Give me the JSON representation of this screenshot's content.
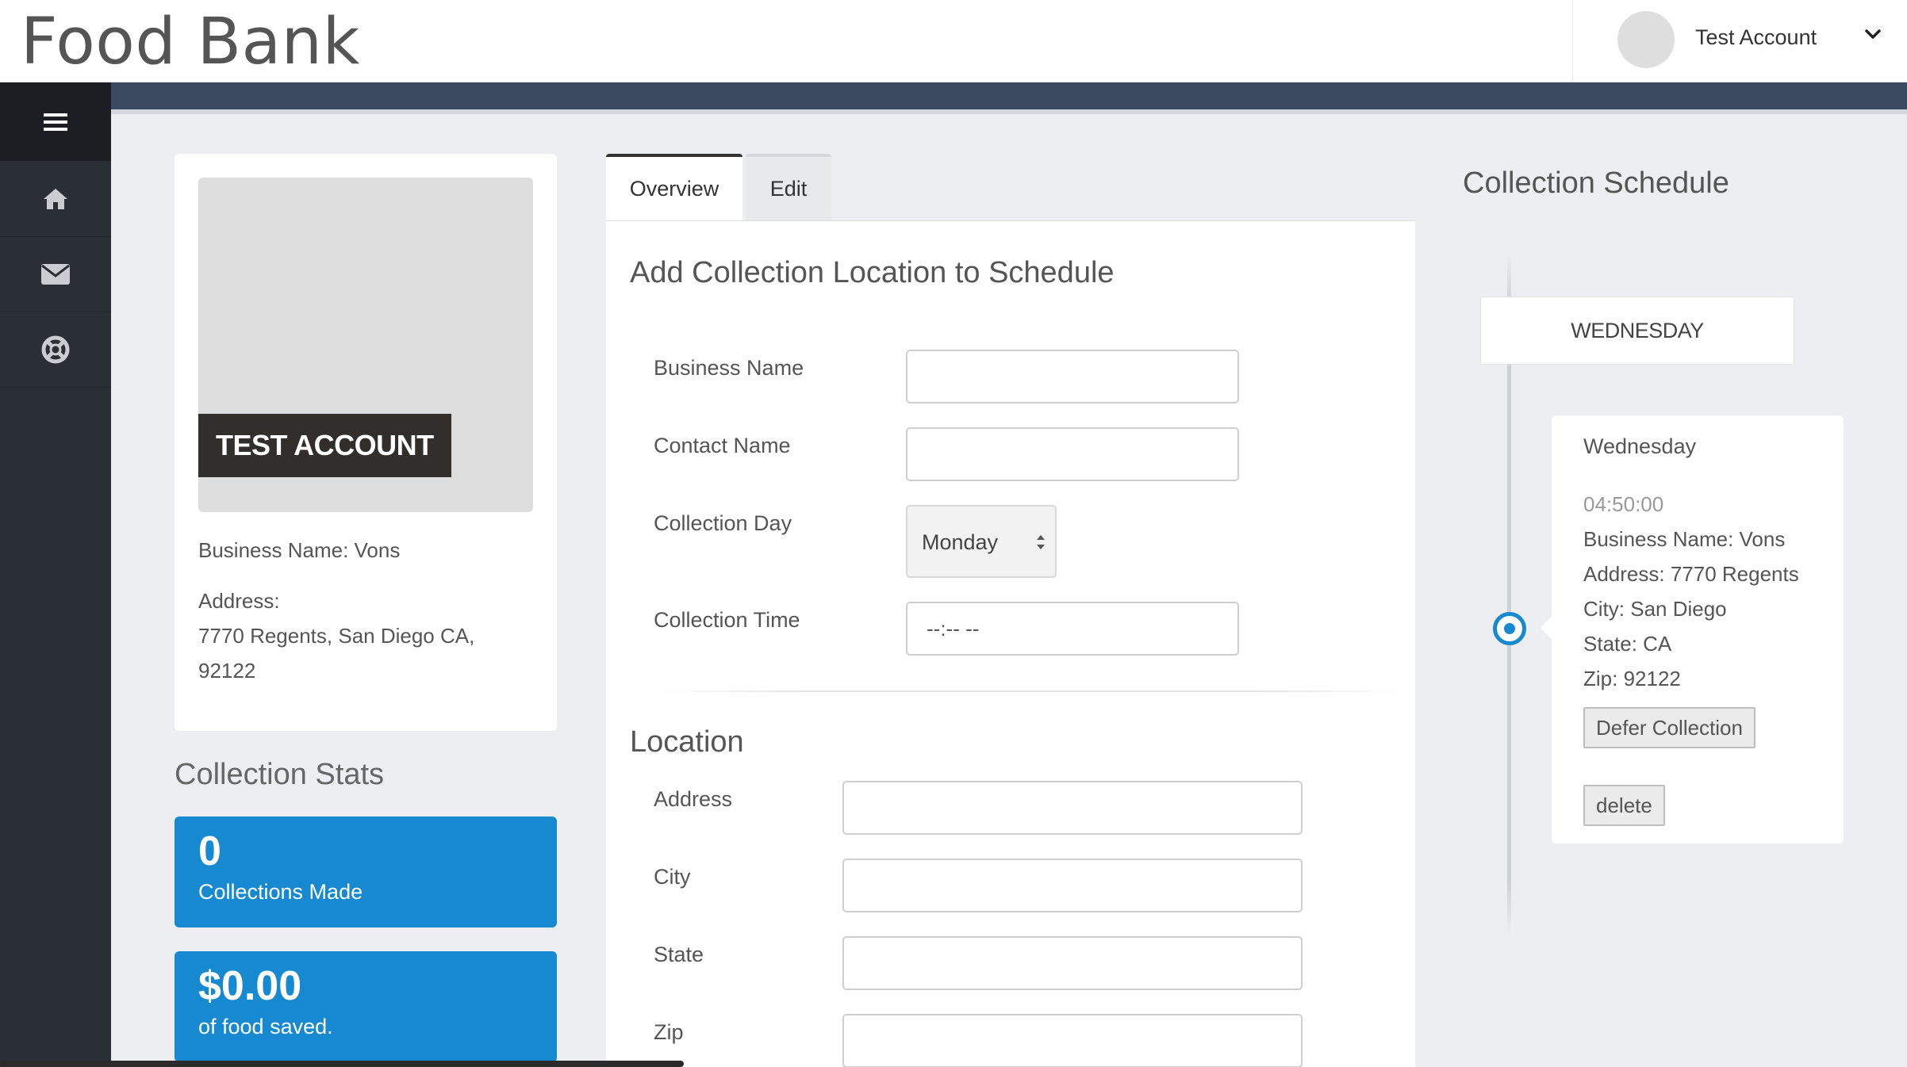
{
  "header": {
    "brand": "Food Bank",
    "account_name": "Test Account",
    "account_menu_icon": "chevron-down-icon"
  },
  "sidebar": {
    "items": [
      {
        "icon": "menu-icon"
      },
      {
        "icon": "home-icon"
      },
      {
        "icon": "mail-icon"
      },
      {
        "icon": "lifebuoy-icon"
      }
    ]
  },
  "profile": {
    "tag": "TEST ACCOUNT",
    "business_line": "Business Name: Vons",
    "address_label": "Address:",
    "address_line1": "7770 Regents, San Diego CA,",
    "address_line2": "92122"
  },
  "stats": {
    "title": "Collection Stats",
    "collections_value": "0",
    "collections_label": "Collections Made",
    "saved_value": "$0.00",
    "saved_label": "of food saved.",
    "accent": "#1789d1"
  },
  "tabs": [
    {
      "label": "Overview",
      "active": true
    },
    {
      "label": "Edit",
      "active": false
    }
  ],
  "form": {
    "title": "Add Collection Location to Schedule",
    "business_name_label": "Business Name",
    "business_name_value": "",
    "contact_name_label": "Contact Name",
    "contact_name_value": "",
    "collection_day_label": "Collection Day",
    "collection_day_value": "Monday",
    "collection_time_label": "Collection Time",
    "collection_time_value": "--:-- --",
    "location_title": "Location",
    "address_label": "Address",
    "address_value": "",
    "city_label": "City",
    "city_value": "",
    "state_label": "State",
    "state_value": "",
    "zip_label": "Zip",
    "zip_value": ""
  },
  "schedule": {
    "title": "Collection Schedule",
    "day_header": "WEDNESDAY",
    "event": {
      "day": "Wednesday",
      "time": "04:50:00",
      "business": "Business Name: Vons",
      "address": "Address: 7770 Regents",
      "city": "City: San Diego",
      "state": "State: CA",
      "zip": "Zip: 92122",
      "defer_label": "Defer Collection",
      "delete_label": "delete"
    }
  }
}
